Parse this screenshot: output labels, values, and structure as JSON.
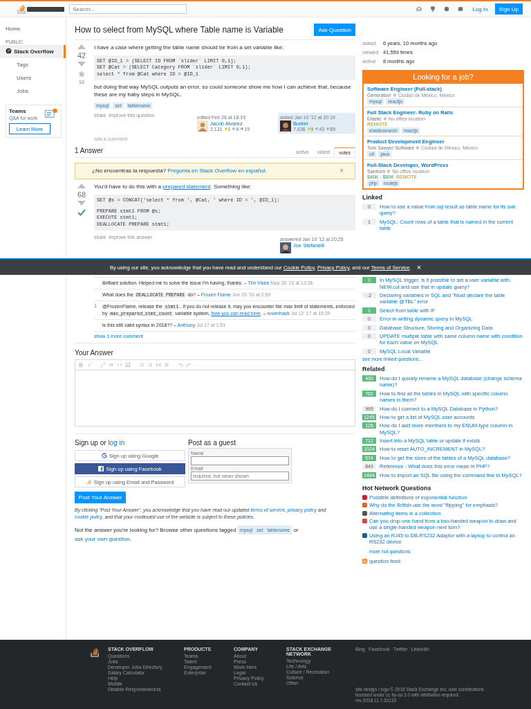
{
  "header": {
    "search_placeholder": "Search...",
    "login": "Log In",
    "signup": "Sign Up"
  },
  "nav": {
    "items": [
      {
        "label": "Home",
        "kind": "top",
        "selected": false
      },
      {
        "label": "PUBLIC",
        "kind": "section",
        "selected": false
      },
      {
        "label": "Stack Overflow",
        "kind": "site",
        "selected": true
      },
      {
        "label": "Tags",
        "kind": "sub",
        "selected": false
      },
      {
        "label": "Users",
        "kind": "sub",
        "selected": false
      },
      {
        "label": "Jobs",
        "kind": "sub",
        "selected": false
      }
    ],
    "teams": {
      "title": "Teams",
      "subtitle": "Q&A for work",
      "button": "Learn More"
    }
  },
  "question": {
    "title": "How to select from MySQL where Table name is Variable",
    "ask_button": "Ask Question",
    "votes": "42",
    "favorites": "10",
    "intro": "I have a case where getting the table name should be from a set variable like:",
    "code": [
      "SET @ID_1 = (SELECT ID FROM `slider` LIMIT 0,1);",
      "SET @Cat = (SELECT Category FROM `slider` LIMIT 0,1);",
      "select * from @Cat where ID = @ID_1"
    ],
    "outro": "but doing that way MySQL outputs an error, so could someone show me how I can achieve that, because these are my baby steps in MySQL.",
    "tags": [
      "mysql",
      "set",
      "tablename"
    ],
    "actions": [
      "share",
      "improve this question"
    ],
    "editor": {
      "action": "edited Feb 28 at 18:19",
      "name": "Jacob Alvarez",
      "rep": "2,131",
      "badges": [
        {
          "color": "#ffcc01",
          "count": "1"
        },
        {
          "color": "#b4b8bc",
          "count": "6"
        },
        {
          "color": "#d1a684",
          "count": "15"
        }
      ]
    },
    "owner": {
      "action": "asked Jan 10 '12 at 20:19",
      "name": "Burimi",
      "rep": "7,438",
      "badges": [
        {
          "color": "#ffcc01",
          "count": "9"
        },
        {
          "color": "#b4b8bc",
          "count": "43"
        },
        {
          "color": "#d1a684",
          "count": "85"
        }
      ]
    },
    "add_comment": "add a comment"
  },
  "answers_header": {
    "title": "1 Answer",
    "sort_tabs": [
      {
        "label": "active",
        "selected": false
      },
      {
        "label": "oldest",
        "selected": false
      },
      {
        "label": "votes",
        "selected": true
      }
    ]
  },
  "notice": {
    "parts": [
      {
        "kind": "text",
        "text": "¿No encuentras la respuesta? "
      },
      {
        "kind": "link",
        "text": "Pregunta en Stack Overflow en español"
      },
      {
        "kind": "text",
        "text": "."
      }
    ],
    "close": "×"
  },
  "answer": {
    "votes": "68",
    "accepted": true,
    "parts": [
      {
        "kind": "text",
        "text": "You'd have to do this with a "
      },
      {
        "kind": "link",
        "text": "prepared statement"
      },
      {
        "kind": "text",
        "text": ". Something like:"
      }
    ],
    "code": [
      [
        "SET @s = CONCAT('select * from ', @Cat, ' where ID = ', @ID_1);"
      ],
      [
        "PREPARE stmt1 FROM @s;",
        "EXECUTE stmt1;",
        "DEALLOCATE PREPARE stmt1;"
      ]
    ],
    "actions": [
      "share",
      "improve this answer"
    ],
    "owner": {
      "action": "answered Jan 10 '12 at 20:25",
      "name": "Joe Stefanelli"
    },
    "comments": [
      {
        "parts": [
          {
            "kind": "text",
            "text": "Brilliant solution. Helped me to solve the issue I'm having, thanks. "
          }
        ],
        "dash": "–",
        "user": "Tim Visée",
        "date": "May 28 '16 at 12:36"
      },
      {
        "parts": [
          {
            "kind": "text",
            "text": "What does the "
          },
          {
            "kind": "code",
            "text": "DEALLOCATE PREPARE"
          },
          {
            "kind": "text",
            "text": " do? "
          }
        ],
        "dash": "–",
        "user": "Frozen Flame",
        "date": "Jun 29 '16 at 2:59"
      },
      {
        "score": "1",
        "parts": [
          {
            "kind": "text",
            "text": "@FrozenFlame, release the "
          },
          {
            "kind": "code",
            "text": "stmt1"
          },
          {
            "kind": "text",
            "text": ". If you do not release it, may you encounter the max limit of statements, enforced by "
          },
          {
            "kind": "code",
            "text": "max_prepared_stmt_count"
          },
          {
            "kind": "text",
            "text": " variable system, "
          },
          {
            "kind": "link",
            "text": "how you can read here"
          },
          {
            "kind": "text",
            "text": ". "
          }
        ],
        "dash": "–",
        "user": "ruvenhack",
        "date": "Jul 12 '17 at 19:29"
      },
      {
        "parts": [
          {
            "kind": "text",
            "text": "is this still valid syntax in 2018?? "
          }
        ],
        "dash": "–",
        "user": "Anthony",
        "date": "Jul 17 at 1:51"
      }
    ],
    "more_comments": "show 1 more comment"
  },
  "cookie_banner": {
    "parts": [
      {
        "kind": "text",
        "text": "By using our site, you acknowledge that you have read and understand our "
      },
      {
        "kind": "link",
        "text": "Cookie Policy"
      },
      {
        "kind": "text",
        "text": ", "
      },
      {
        "kind": "link",
        "text": "Privacy Policy"
      },
      {
        "kind": "text",
        "text": ", and our "
      },
      {
        "kind": "link",
        "text": "Terms of Service"
      },
      {
        "kind": "text",
        "text": "."
      }
    ],
    "close": "×"
  },
  "your_answer": {
    "title": "Your Answer"
  },
  "signup": {
    "title_parts": [
      {
        "kind": "text",
        "text": "Sign up or "
      },
      {
        "kind": "link",
        "text": "log in"
      }
    ],
    "buttons": [
      {
        "kind": "google",
        "label": "Sign up using Google"
      },
      {
        "kind": "facebook",
        "label": "Sign up using Facebook"
      },
      {
        "kind": "email",
        "label": "Sign up using Email and Password"
      }
    ],
    "guest_title": "Post as a guest",
    "name_label": "Name",
    "email_label": "Email",
    "email_placeholder": "required, but never shown"
  },
  "post_button": "Post Your Answer",
  "terms": {
    "parts": [
      {
        "kind": "text",
        "text": "By clicking \"Post Your Answer\", you acknowledge that you have read our updated "
      },
      {
        "kind": "link",
        "text": "terms of service"
      },
      {
        "kind": "text",
        "text": ", "
      },
      {
        "kind": "link",
        "text": "privacy policy"
      },
      {
        "kind": "text",
        "text": " and "
      },
      {
        "kind": "link",
        "text": "cookie policy"
      },
      {
        "kind": "text",
        "text": ", and that your continued use of the website is subject to these policies."
      }
    ]
  },
  "browse": {
    "before": "Not the answer you're looking for? Browse other questions tagged ",
    "tags": [
      "mysql",
      "set",
      "tablename"
    ],
    "middle": " or ",
    "link": "ask your own question",
    "after": "."
  },
  "sidebar": {
    "meta": [
      {
        "label": "asked",
        "value": "6 years, 10 months ago"
      },
      {
        "label": "viewed",
        "value": "41,559 times"
      },
      {
        "label": "active",
        "value": "8 months ago"
      }
    ],
    "jobs": {
      "title": "Looking for a job?",
      "items": [
        {
          "title": "Software Engineer (Full-stack)",
          "company": "Generation",
          "location": "Ciudad de México, México",
          "tags": [
            "mysql",
            "reactjs"
          ]
        },
        {
          "title": "Full Stack Engineer- Ruby on Rails",
          "company": "Elastic",
          "location": "No office location",
          "remote_label": "REMOTE",
          "tags": [
            "elasticsearch",
            "reactjs"
          ]
        },
        {
          "title": "Product Development Engineer",
          "company": "Tom Sawyer Software",
          "location": "Ciudad de México, México",
          "tags": [
            "c#",
            "java"
          ]
        },
        {
          "title": "Full-Stack Developer, WordPress",
          "company": "Sanborn",
          "location": "No office location",
          "salary": "$40K - $60K",
          "remote_label": "REMOTE",
          "tags": [
            "php",
            "nodejs"
          ]
        }
      ]
    },
    "linked": {
      "title": "Linked",
      "items": [
        {
          "score": "0",
          "accepted": false,
          "text": "How to use a value from sql result as table name for its sub query?"
        },
        {
          "score": "1",
          "accepted": false,
          "text": "MySQL: Count rows of a table that is named in the current table"
        },
        {
          "score": "1",
          "accepted": true,
          "text": "In MySQL trigger, is it possible to set a user variable with NEW.col and use that in update query?"
        },
        {
          "score": "-2",
          "accepted": false,
          "text": "Declaring variables in SQL and \"Must declare the table variable @TBL\" error"
        },
        {
          "score": "1",
          "accepted": true,
          "text": "Select from table with IF"
        },
        {
          "score": "0",
          "accepted": false,
          "text": "Error in writing dynamic query in MySQL"
        },
        {
          "score": "0",
          "accepted": false,
          "text": "Database Structure, Storing and Organizing Data"
        },
        {
          "score": "0",
          "accepted": false,
          "text": "UPDATE multiple table with same column name with condition for each value on MySQL"
        },
        {
          "score": "0",
          "accepted": false,
          "text": "MySQL Local Variable"
        }
      ],
      "more": "see more linked questions…"
    },
    "related": {
      "title": "Related",
      "items": [
        {
          "score": "430",
          "accepted": true,
          "text": "How do I quickly rename a MySQL database (change schema name)?"
        },
        {
          "score": "762",
          "accepted": true,
          "text": "How to find all the tables in MySQL with specific column names in them?"
        },
        {
          "score": "995",
          "accepted": false,
          "text": "How do I connect to a MySQL Database in Python?"
        },
        {
          "score": "1245",
          "accepted": true,
          "text": "How to get a list of MySQL user accounts"
        },
        {
          "score": "126",
          "accepted": true,
          "text": "How do I add more members to my ENUM-type column in MySQL?"
        },
        {
          "score": "712",
          "accepted": true,
          "text": "Insert into a MySQL table or update if exists"
        },
        {
          "score": "1024",
          "accepted": true,
          "text": "How to reset AUTO_INCREMENT in MySQL?"
        },
        {
          "score": "574",
          "accepted": true,
          "text": "How to get the sizes of the tables of a MySQL database?"
        },
        {
          "score": "849",
          "accepted": false,
          "text": "Reference - What does this error mean in PHP?"
        },
        {
          "score": "1464",
          "accepted": true,
          "text": "How to import an SQL file using the command line in MySQL?"
        }
      ]
    },
    "hot": {
      "title": "Hot Network Questions",
      "items": [
        {
          "color": "#c0282d",
          "text": "Possible definitions of exponential function"
        },
        {
          "color": "#e5652e",
          "text": "Why do the British use the word \"flipping\" for emphasis?"
        },
        {
          "color": "#555555",
          "text": "Alternating items in a collection"
        },
        {
          "color": "#d34a3a",
          "text": "Can you drop one hand from a two-handed weapon to draw and use a single-handed weapon next turn?"
        },
        {
          "color": "#1f5a91",
          "text": "Using an RJ45 to DB-RS232 Adaptor with a laptop to control an RS232 device"
        }
      ],
      "more": "more hot questions"
    },
    "feed": "question feed"
  },
  "footer": {
    "columns": [
      {
        "title": "STACK OVERFLOW",
        "links": [
          "Questions",
          "Jobs",
          "Developer Jobs Directory",
          "Salary Calculator",
          "Help",
          "Mobile",
          "Disable Responsiveness"
        ]
      },
      {
        "title": "PRODUCTS",
        "links": [
          "Teams",
          "Talent",
          "Engagement",
          "Enterprise"
        ]
      },
      {
        "title": "COMPANY",
        "links": [
          "About",
          "Press",
          "Work Here",
          "Legal",
          "Privacy Policy",
          "Contact Us"
        ]
      },
      {
        "title": "STACK EXCHANGE NETWORK",
        "links": [
          "Technology",
          "Life / Arts",
          "Culture / Recreation",
          "Science",
          "Other"
        ]
      }
    ],
    "social": [
      "Blog",
      "Facebook",
      "Twitter",
      "LinkedIn"
    ],
    "copyright": [
      "site design / logo © 2018 Stack Exchange Inc; user contributions",
      "licensed under cc by-sa 3.0 with attribution required.",
      "rev 2018.11.7.32133"
    ]
  }
}
